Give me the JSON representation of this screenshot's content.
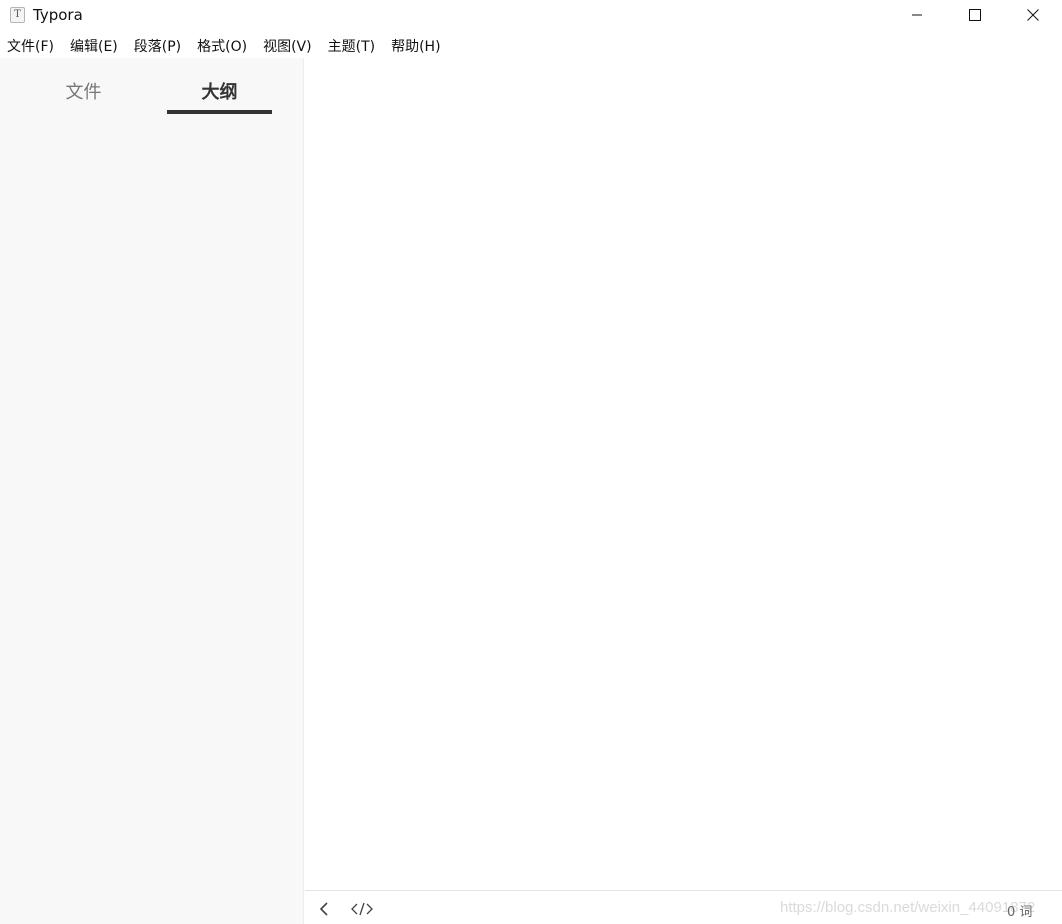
{
  "window": {
    "title": "Typora",
    "app_icon_letter": "T",
    "controls": {
      "minimize": "minimize-icon",
      "maximize": "maximize-icon",
      "close": "close-icon"
    }
  },
  "menubar": {
    "items": [
      {
        "label": "文件(F)"
      },
      {
        "label": "编辑(E)"
      },
      {
        "label": "段落(P)"
      },
      {
        "label": "格式(O)"
      },
      {
        "label": "视图(V)"
      },
      {
        "label": "主题(T)"
      },
      {
        "label": "帮助(H)"
      }
    ]
  },
  "sidebar": {
    "tabs": [
      {
        "label": "文件",
        "active": false
      },
      {
        "label": "大纲",
        "active": true
      }
    ],
    "background": "#f8f8f8"
  },
  "footer": {
    "back_icon": "chevron-left-icon",
    "source_icon": "code-icon",
    "watermark": "https://blog.csdn.net/weixin_44091872",
    "word_count": "0 词"
  }
}
